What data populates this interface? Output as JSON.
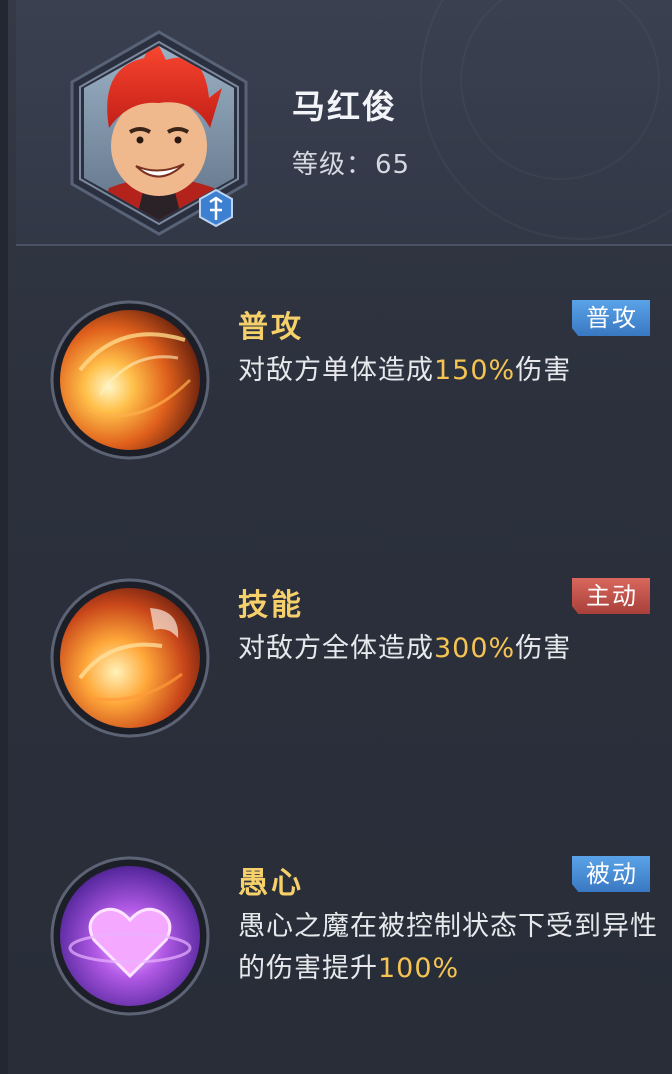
{
  "hero": {
    "name": "马红俊",
    "level_label": "等级：",
    "level_value": "65"
  },
  "skills": [
    {
      "name": "普攻",
      "badge": "普攻",
      "badge_color": "#4a8fd8",
      "desc_before": "对敌方单体造成",
      "desc_value": "150%",
      "desc_after": "伤害",
      "icon": "fireball-icon"
    },
    {
      "name": "技能",
      "badge": "主动",
      "badge_color": "#c2524b",
      "desc_before": "对敌方全体造成",
      "desc_value": "300%",
      "desc_after": "伤害",
      "icon": "phoenix-fire-icon"
    },
    {
      "name": "愚心",
      "badge": "被动",
      "badge_color": "#4a8fd8",
      "desc_before": "愚心之魔在被控制状态下受到异性的伤害提升",
      "desc_value": "100%",
      "desc_after": "",
      "icon": "purple-heart-icon"
    }
  ],
  "colors": {
    "skill_name": "#f5d06b",
    "highlight": "#f5c453",
    "panel_bg": "#2b303c"
  }
}
